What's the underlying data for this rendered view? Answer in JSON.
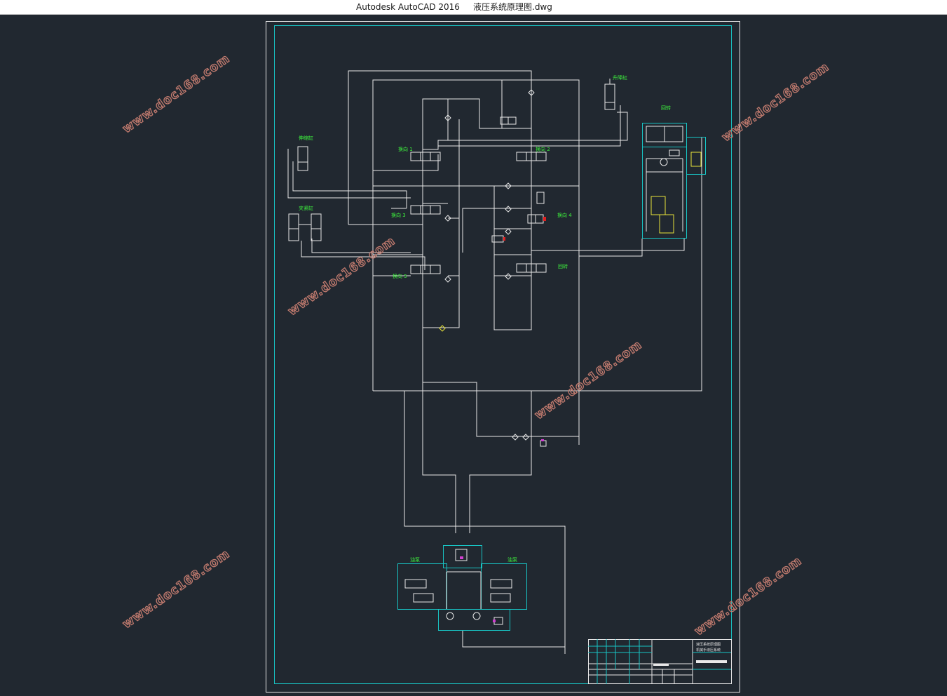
{
  "window": {
    "app_name": "Autodesk AutoCAD 2016",
    "file_name": "液压系统原理图.dwg"
  },
  "watermark": {
    "text": "www.doc168.com"
  },
  "colors": {
    "background": "#212830",
    "lines": "#e9e9e9",
    "frame": "#18c4c4",
    "labels": "#3df23d",
    "watermark": "#c07a6e",
    "highlight": "#e8e23a",
    "marker": "#d040d0"
  },
  "drawing": {
    "component_labels": [
      {
        "id": "lift-cylinder",
        "text": "升降缸"
      },
      {
        "id": "rotate",
        "text": "回转"
      },
      {
        "id": "arm-cylinder",
        "text": "伸缩缸"
      },
      {
        "id": "valve-1",
        "text": "换向 1"
      },
      {
        "id": "valve-2",
        "text": "换向 2"
      },
      {
        "id": "clamp-cylinder",
        "text": "夹紧缸"
      },
      {
        "id": "valve-3",
        "text": "换向 3"
      },
      {
        "id": "valve-4",
        "text": "换向 4"
      },
      {
        "id": "valve-5",
        "text": "换向 5"
      },
      {
        "id": "valve-6",
        "text": "回转"
      },
      {
        "id": "pump-left",
        "text": "油泵"
      },
      {
        "id": "pump-right",
        "text": "油泵"
      }
    ],
    "title_block": {
      "drawing_title": "液压系统原理图",
      "subtitle": "机械手液压系统"
    }
  }
}
